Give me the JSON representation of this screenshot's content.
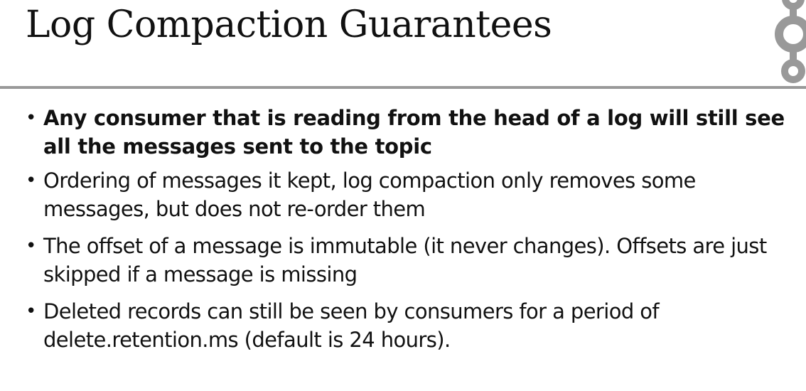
{
  "slide": {
    "title": "Log Compaction Guarantees",
    "bullets": [
      {
        "text": "Any consumer that is reading from the head of a log will still see all the messages sent to the topic",
        "bold": true
      },
      {
        "text": "Ordering of messages it kept, log compaction only removes some messages, but does not re-order them",
        "bold": false
      },
      {
        "text": "The offset of a message is immutable (it never changes). Offsets are just skipped if a message is missing",
        "bold": false
      },
      {
        "text": "Deleted records can still be seen by consumers for a period of delete.retention.ms (default is 24 hours).",
        "bold": false
      }
    ]
  },
  "colors": {
    "text": "#111111",
    "rule": "#999999",
    "logo": "#999999",
    "background": "#ffffff"
  },
  "icons": {
    "logo": "kafka-logo-icon",
    "bullet": "bullet-dot"
  }
}
